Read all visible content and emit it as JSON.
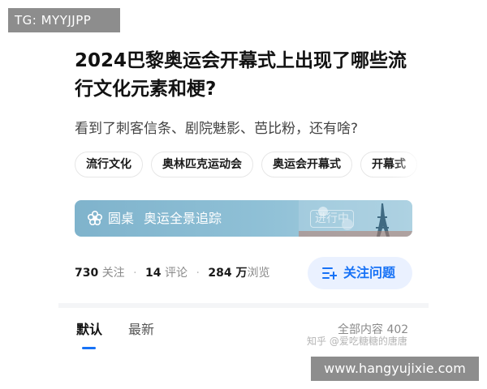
{
  "overlay": {
    "tg_label": "TG: MYYJJPP",
    "site_url": "www.hangyujixie.com"
  },
  "question": {
    "title": "2024巴黎奥运会开幕式上出现了哪些流行文化元素和梗?",
    "description": "看到了刺客信条、剧院魅影、芭比粉，还有啥?"
  },
  "tags": [
    "流行文化",
    "奥林匹克运动会",
    "奥运会开幕式",
    "开幕式"
  ],
  "banner": {
    "brand": "圆桌",
    "topic": "奥运全景追踪",
    "status": "进行中",
    "icon": "flower-icon",
    "color_start": "#7fb3cc",
    "color_end": "#a9cfe0"
  },
  "stats": {
    "followers_count": "730",
    "followers_label": "关注",
    "comments_count": "14",
    "comments_label": "评论",
    "views_count": "284 万",
    "views_label": "浏览"
  },
  "follow_button": {
    "label": "关注问题",
    "icon": "follow-list-plus-icon",
    "accent": "#1772f6"
  },
  "tabs": {
    "default_label": "默认",
    "latest_label": "最新",
    "active": "默认"
  },
  "answers_count_label": "全部内容 402",
  "watermark": "知乎 @爱吃糖糖的唐唐"
}
